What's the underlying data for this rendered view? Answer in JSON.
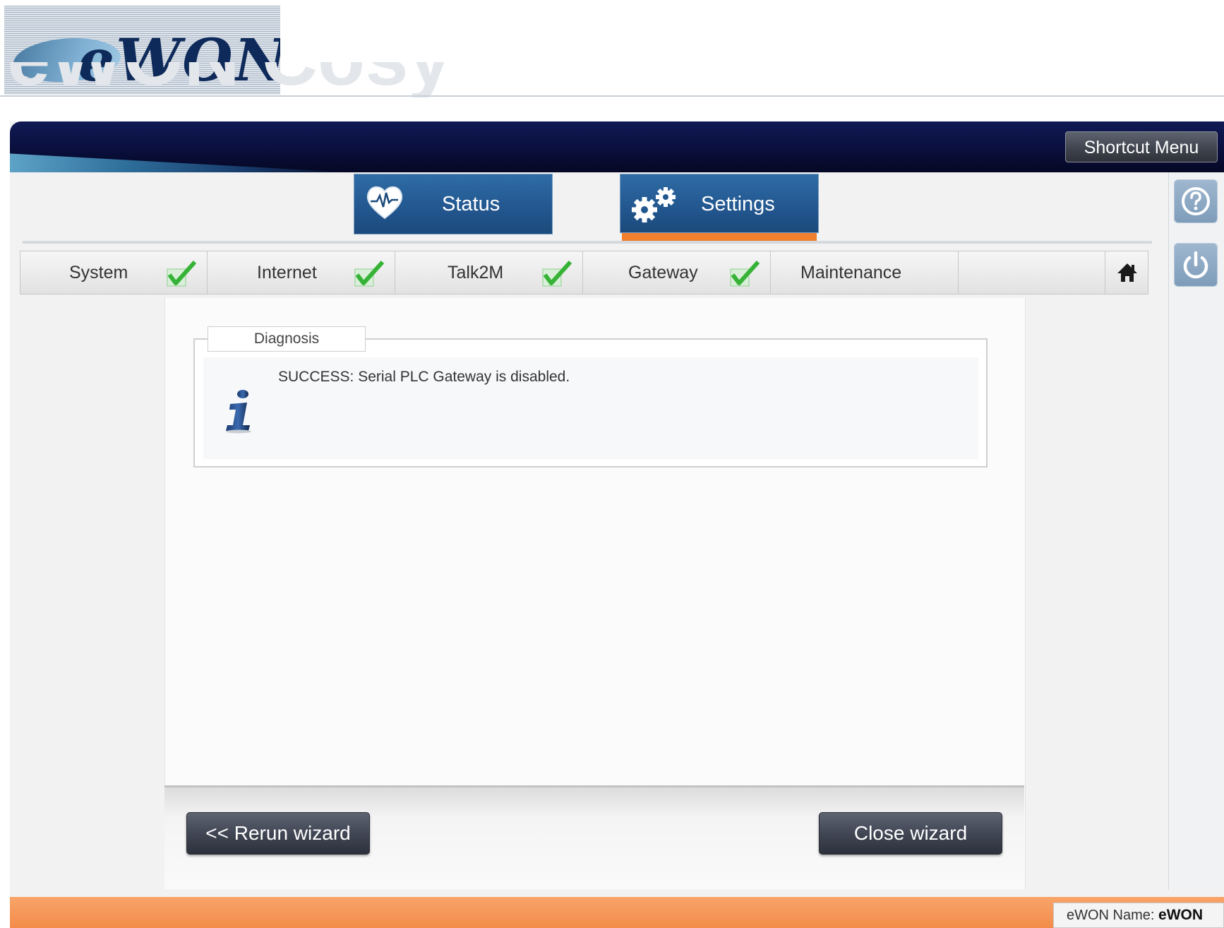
{
  "logo": {
    "text": "eWON"
  },
  "header": {
    "ghost_title": "eWON Cosy",
    "shortcut_menu_label": "Shortcut Menu"
  },
  "tabs": [
    {
      "label": "Status",
      "icon": "heart-monitor-icon",
      "selected": false
    },
    {
      "label": "Settings",
      "icon": "gears-icon",
      "selected": true
    }
  ],
  "side_buttons": [
    {
      "name": "help",
      "icon": "question-icon"
    },
    {
      "name": "power",
      "icon": "power-icon"
    }
  ],
  "steps": [
    {
      "label": "System",
      "done": true
    },
    {
      "label": "Internet",
      "done": true
    },
    {
      "label": "Talk2M",
      "done": true
    },
    {
      "label": "Gateway",
      "done": true
    },
    {
      "label": "Maintenance",
      "done": false
    }
  ],
  "diagnosis": {
    "legend": "Diagnosis",
    "message": "SUCCESS: Serial PLC Gateway is disabled."
  },
  "footer": {
    "rerun_label": "<< Rerun wizard",
    "close_label": "Close wizard"
  },
  "status_bar": {
    "name_label": "eWON Name:",
    "name_value": "eWON"
  },
  "colors": {
    "header_navy": "#0a0f3d",
    "tab_blue": "#22568e",
    "accent_orange": "#f07f2e",
    "check_green": "#3cb83c"
  }
}
